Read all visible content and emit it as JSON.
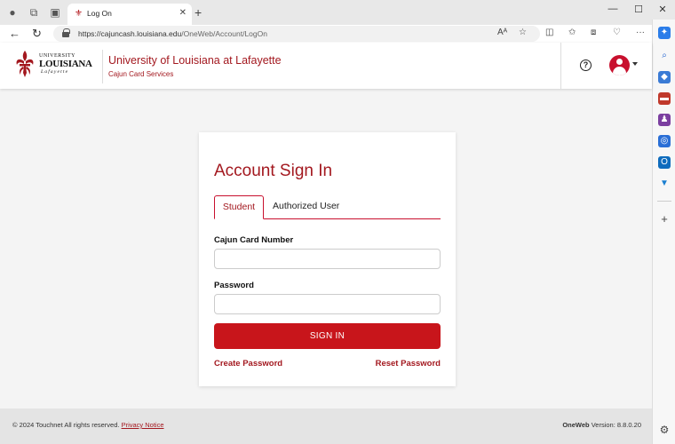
{
  "browser": {
    "tab_title": "Log On",
    "url_host": "https://cajuncash.louisiana.edu",
    "url_path": "/OneWeb/Account/LogOn"
  },
  "header": {
    "logo_university": "UNIVERSITY",
    "logo_louisiana": "LOUISIANA",
    "logo_lafayette": "Lafayette",
    "site_title": "University of Louisiana at Lafayette",
    "site_subtitle": "Cajun Card Services",
    "help_glyph": "?"
  },
  "signin": {
    "title": "Account Sign In",
    "tabs": [
      "Student",
      "Authorized User"
    ],
    "card_number_label": "Cajun Card Number",
    "card_number_value": "",
    "password_label": "Password",
    "password_value": "",
    "submit_label": "SIGN IN",
    "create_password": "Create Password",
    "reset_password": "Reset Password"
  },
  "footer": {
    "copyright": "© 2024 Touchnet All rights reserved.",
    "privacy": "Privacy Notice",
    "product": "OneWeb",
    "version": "Version: 8.8.0.20"
  },
  "colors": {
    "brand_red": "#a3181f",
    "button_red": "#c8151b"
  },
  "icons": {
    "profile": "profile-icon",
    "workspaces": "workspaces-icon",
    "tab_actions": "tab-actions-icon",
    "back": "back-arrow-icon",
    "refresh": "refresh-icon",
    "lock": "lock-icon",
    "read_aloud": "read-aloud-icon",
    "favorite": "star-icon",
    "help": "help-circle-icon",
    "user": "user-avatar-icon"
  }
}
